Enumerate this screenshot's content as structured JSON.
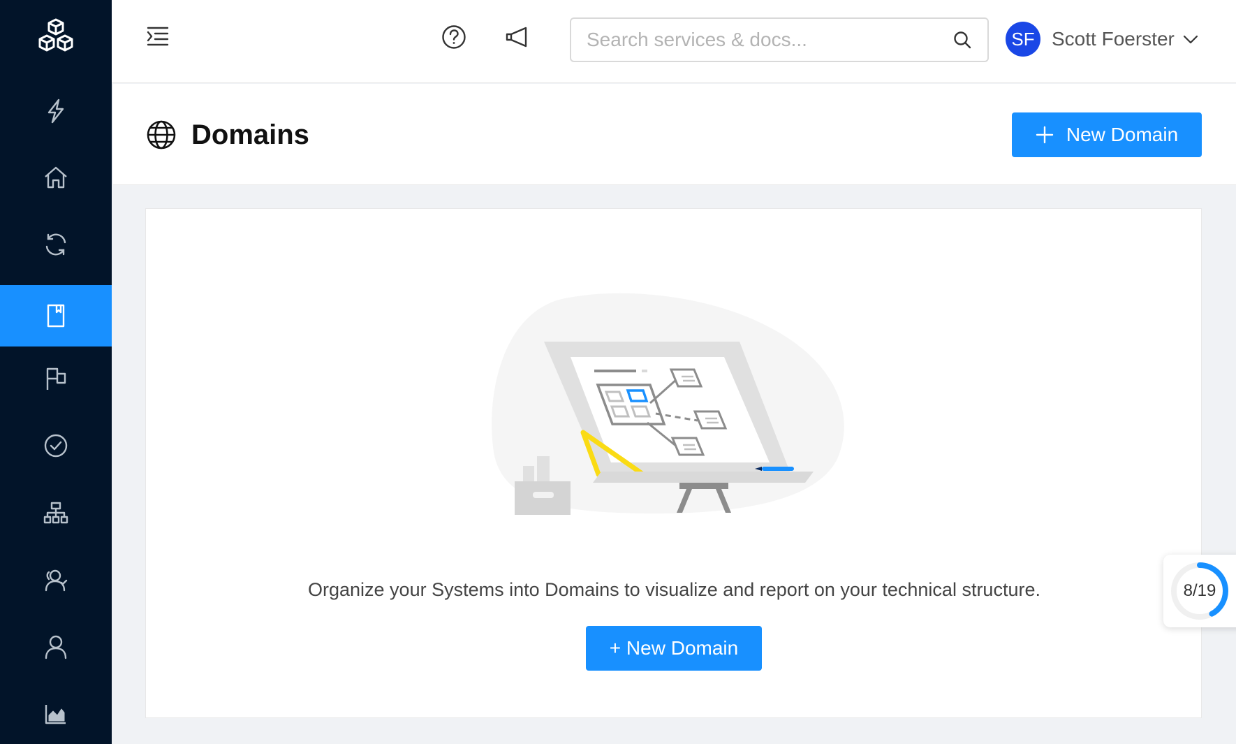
{
  "sidebar": {
    "logo_icon": "cubes-logo-icon",
    "items": [
      {
        "icon": "lightning-icon",
        "active": false
      },
      {
        "icon": "home-icon",
        "active": false
      },
      {
        "icon": "sync-icon",
        "active": false
      },
      {
        "icon": "book-icon",
        "active": true
      },
      {
        "icon": "flag-icon",
        "active": false
      },
      {
        "icon": "check-circle-icon",
        "active": false
      },
      {
        "icon": "hierarchy-icon",
        "active": false
      },
      {
        "icon": "team-icon",
        "active": false
      },
      {
        "icon": "user-icon",
        "active": false
      },
      {
        "icon": "area-chart-icon",
        "active": false
      }
    ]
  },
  "header": {
    "search": {
      "placeholder": "Search services & docs...",
      "value": ""
    },
    "user": {
      "initials": "SF",
      "name": "Scott Foerster"
    }
  },
  "page": {
    "title": "Domains",
    "new_button_label": "New Domain"
  },
  "empty_state": {
    "description": "Organize your Systems into Domains to visualize and report on your technical structure.",
    "button_label": "+ New Domain"
  },
  "progress": {
    "label": "8/19",
    "completed": 8,
    "total": 19
  },
  "colors": {
    "sidebar_bg": "#021429",
    "accent": "#1890ff",
    "avatar_bg": "#1a47e6",
    "page_bg": "#f0f2f5"
  }
}
